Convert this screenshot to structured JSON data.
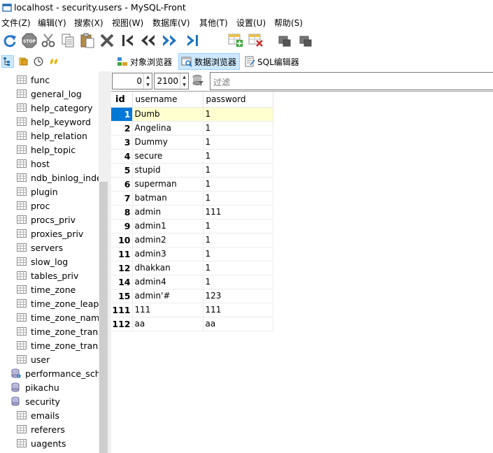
{
  "window": {
    "title": "localhost - security.users - MySQL-Front"
  },
  "menu": [
    "文件(Z)",
    "编辑(Y)",
    "搜索(X)",
    "视图(W)",
    "数据库(V)",
    "其他(T)",
    "设置(U)",
    "帮助(S)"
  ],
  "toolbar_icons": [
    "refresh-icon",
    "stop-icon",
    "cut-icon",
    "copy-icon",
    "paste-icon",
    "delete-icon",
    "first-record-icon",
    "previous-records-icon",
    "next-records-icon",
    "last-record-icon",
    "insert-record-icon",
    "delete-record-icon",
    "post-record-icon",
    "cancel-record-icon"
  ],
  "views": {
    "object_browser": "对象浏览器",
    "data_browser": "数据浏览器",
    "sql_editor": "SQL编辑器"
  },
  "tree": {
    "items": [
      {
        "label": "func",
        "type": "table",
        "indent": 2
      },
      {
        "label": "general_log",
        "type": "table",
        "indent": 2
      },
      {
        "label": "help_category",
        "type": "table",
        "indent": 2
      },
      {
        "label": "help_keyword",
        "type": "table",
        "indent": 2
      },
      {
        "label": "help_relation",
        "type": "table",
        "indent": 2
      },
      {
        "label": "help_topic",
        "type": "table",
        "indent": 2
      },
      {
        "label": "host",
        "type": "table",
        "indent": 2
      },
      {
        "label": "ndb_binlog_inde",
        "type": "table",
        "indent": 2
      },
      {
        "label": "plugin",
        "type": "table",
        "indent": 2
      },
      {
        "label": "proc",
        "type": "table",
        "indent": 2
      },
      {
        "label": "procs_priv",
        "type": "table",
        "indent": 2
      },
      {
        "label": "proxies_priv",
        "type": "table",
        "indent": 2
      },
      {
        "label": "servers",
        "type": "table",
        "indent": 2
      },
      {
        "label": "slow_log",
        "type": "table",
        "indent": 2
      },
      {
        "label": "tables_priv",
        "type": "table",
        "indent": 2
      },
      {
        "label": "time_zone",
        "type": "table",
        "indent": 2
      },
      {
        "label": "time_zone_leap_s",
        "type": "table",
        "indent": 2
      },
      {
        "label": "time_zone_name",
        "type": "table",
        "indent": 2
      },
      {
        "label": "time_zone_transi",
        "type": "table",
        "indent": 2
      },
      {
        "label": "time_zone_transi",
        "type": "table",
        "indent": 2
      },
      {
        "label": "user",
        "type": "table",
        "indent": 2
      },
      {
        "label": "performance_sche",
        "type": "database-active",
        "indent": 1
      },
      {
        "label": "pikachu",
        "type": "database",
        "indent": 1
      },
      {
        "label": "security",
        "type": "database",
        "indent": 1
      },
      {
        "label": "emails",
        "type": "table",
        "indent": 2
      },
      {
        "label": "referers",
        "type": "table",
        "indent": 2
      },
      {
        "label": "uagents",
        "type": "table",
        "indent": 2
      }
    ]
  },
  "navigator": {
    "offset": "0",
    "limit": "2100",
    "filter_placeholder": "过滤"
  },
  "grid": {
    "columns": [
      "id",
      "username",
      "password"
    ],
    "rows": [
      [
        "1",
        "Dumb",
        "1"
      ],
      [
        "2",
        "Angelina",
        "1"
      ],
      [
        "3",
        "Dummy",
        "1"
      ],
      [
        "4",
        "secure",
        "1"
      ],
      [
        "5",
        "stupid",
        "1"
      ],
      [
        "6",
        "superman",
        "1"
      ],
      [
        "7",
        "batman",
        "1"
      ],
      [
        "8",
        "admin",
        "111"
      ],
      [
        "9",
        "admin1",
        "1"
      ],
      [
        "10",
        "admin2",
        "1"
      ],
      [
        "11",
        "admin3",
        "1"
      ],
      [
        "12",
        "dhakkan",
        "1"
      ],
      [
        "14",
        "admin4",
        "1"
      ],
      [
        "15",
        "admin'#",
        "123"
      ],
      [
        "111",
        "111",
        "111"
      ],
      [
        "112",
        "aa",
        "aa"
      ]
    ],
    "selected_row": 0
  },
  "colors": {
    "selection": "#0078d7",
    "active_cell": "#ffffd0",
    "active_view": "#cce8ff"
  }
}
